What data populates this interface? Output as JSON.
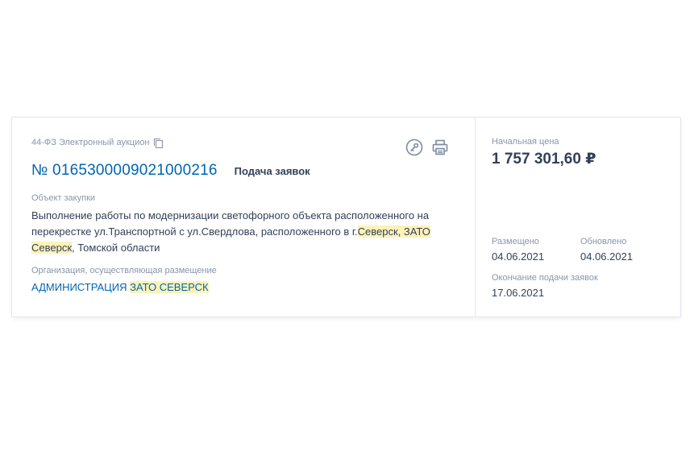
{
  "procurement": {
    "law_type": "44-ФЗ Электронный аукцион",
    "reg_number": "№ 0165300009021000216",
    "stage": "Подача заявок",
    "object_label": "Объект закупки",
    "object_text_part1": "Выполнение работы по модернизации светофорного объекта расположенного на перекрестке ул.Транспортной с ул.Свердлова, расположенного в г.",
    "object_text_highlight": "Северск, ЗАТО Северск",
    "object_text_part2": ", Томской области",
    "org_label": "Организация, осуществляющая размещение",
    "org_name_part1": "АДМИНИСТРАЦИЯ ",
    "org_name_highlight": "ЗАТО СЕВЕРСК"
  },
  "price": {
    "label": "Начальная цена",
    "value": "1 757 301,60 ₽"
  },
  "dates": {
    "published_label": "Размещено",
    "published_value": "04.06.2021",
    "updated_label": "Обновлено",
    "updated_value": "04.06.2021",
    "end_label": "Окончание подачи заявок",
    "end_value": "17.06.2021"
  },
  "icons": {
    "copy": "copy-icon",
    "key": "key-icon",
    "print": "print-icon"
  },
  "colors": {
    "link": "#0065b1",
    "text": "#334059",
    "muted": "#8a95a8",
    "highlight": "#fdf2b8"
  }
}
